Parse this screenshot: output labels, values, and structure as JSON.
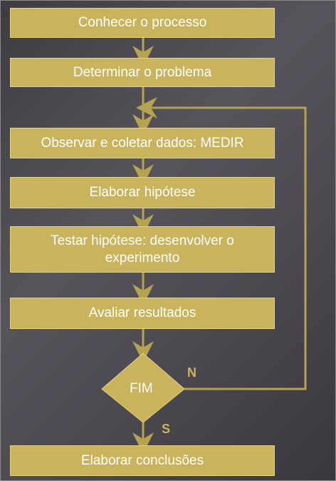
{
  "steps": [
    "Conhecer o processo",
    "Determinar o problema",
    "Observar e coletar dados: MEDIR",
    "Elaborar hipótese",
    "Testar hipótese: desenvolver o experimento",
    "Avaliar resultados"
  ],
  "decision": {
    "label": "FIM",
    "no_label": "N",
    "yes_label": "S"
  },
  "final_step": "Elaborar conclusões",
  "colors": {
    "box_fill": "#c9b35d",
    "line": "#b5a350",
    "background": "#4a474f"
  }
}
